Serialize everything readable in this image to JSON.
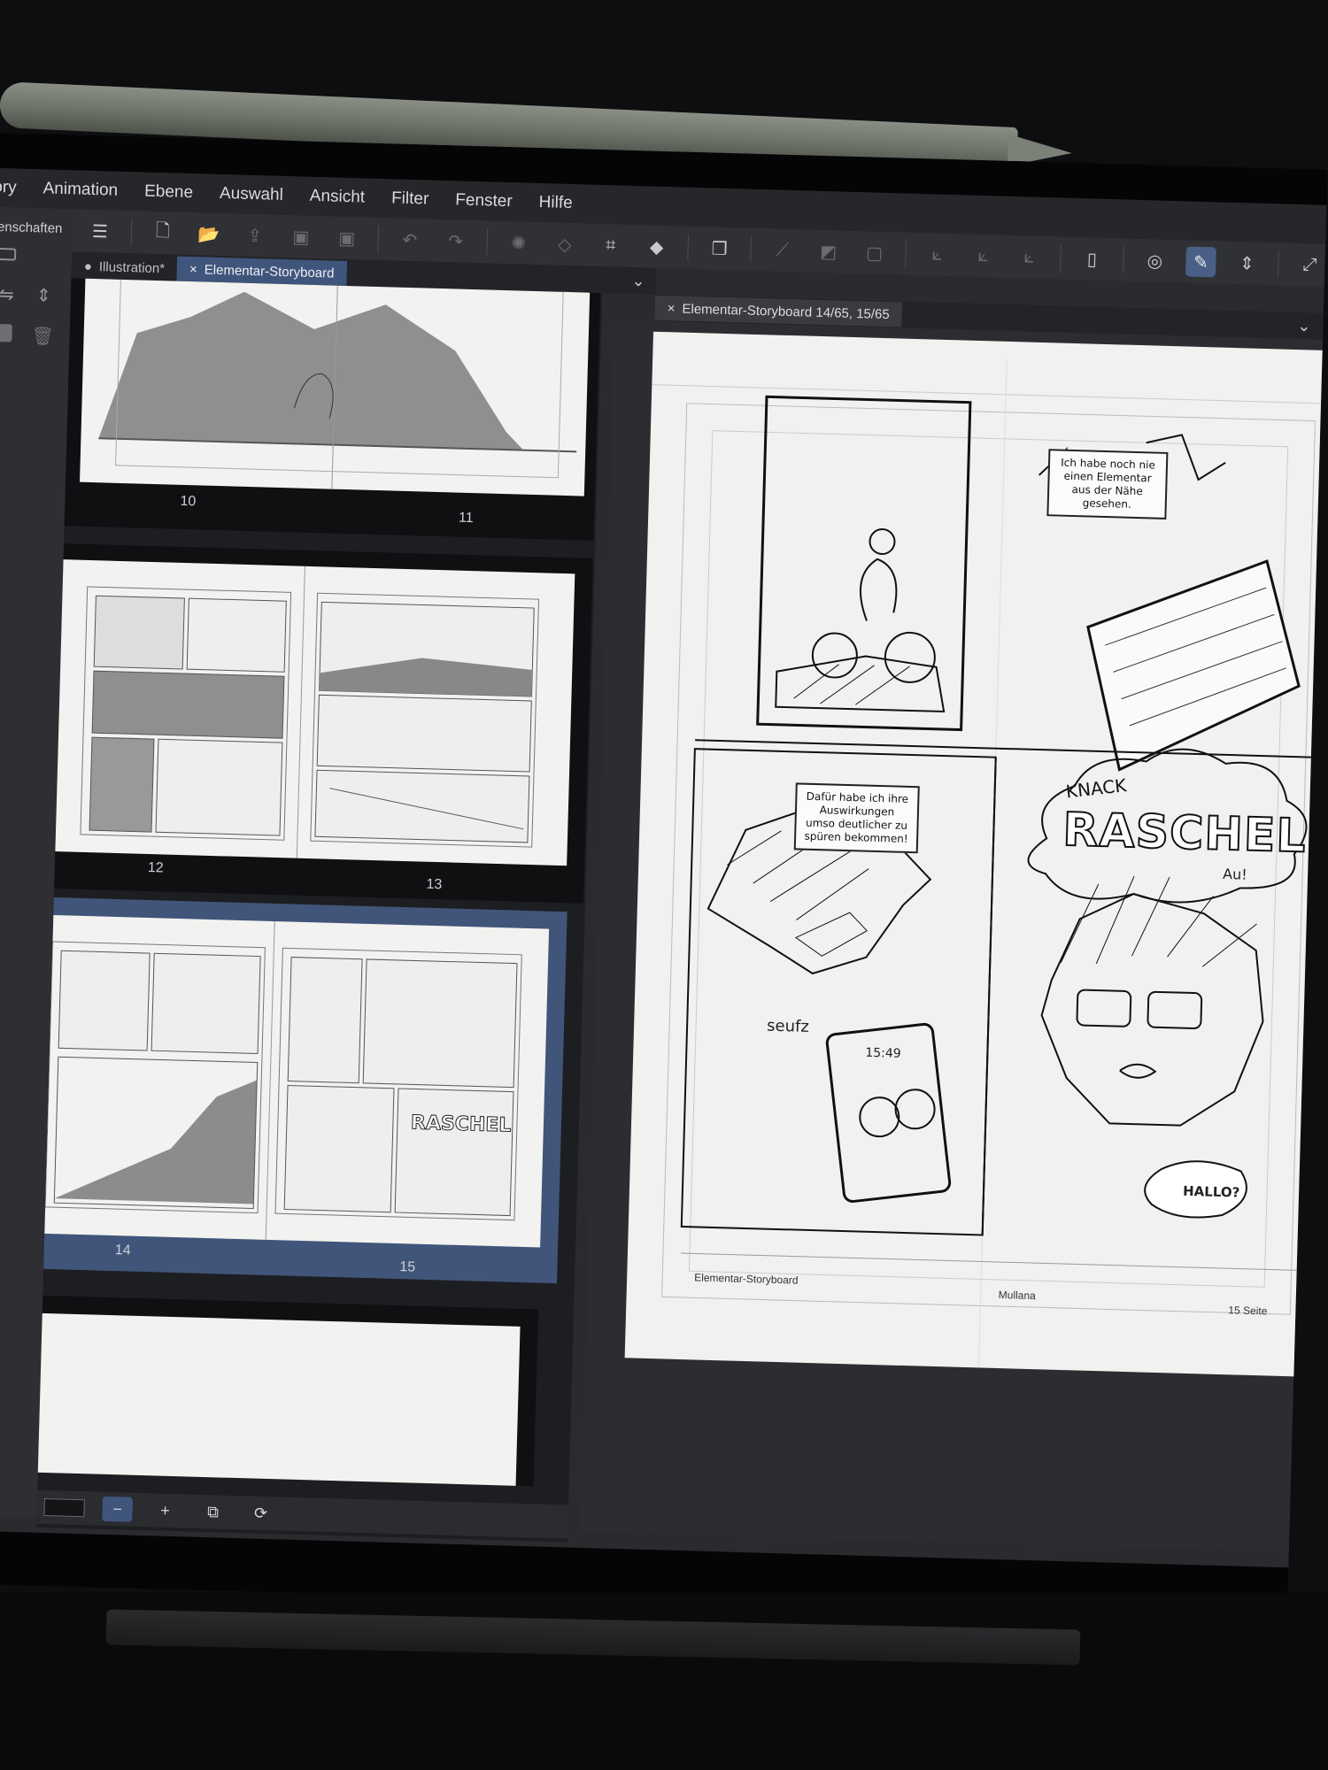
{
  "menu": {
    "items": [
      "ory",
      "Animation",
      "Ebene",
      "Auswahl",
      "Ansicht",
      "Filter",
      "Fenster",
      "Hilfe"
    ]
  },
  "left_panel": {
    "label": "enschaften"
  },
  "tabs_left": [
    {
      "label": "Illustration*",
      "marker": "●"
    },
    {
      "label": "Elementar-Storyboard",
      "marker": "×"
    }
  ],
  "canvas_tab": {
    "label": "Elementar-Storyboard 14/65, 15/65",
    "close": "×"
  },
  "page_list": {
    "spreads": [
      {
        "left_num": "10",
        "right_num": "11",
        "selected": false
      },
      {
        "left_num": "12",
        "right_num": "13",
        "selected": false
      },
      {
        "left_num": "14",
        "right_num": "15",
        "selected": true
      }
    ],
    "bottom_buttons": [
      "−",
      "+",
      "⧉",
      "⟳"
    ]
  },
  "page": {
    "footer_left": "Elementar-Storyboard",
    "footer_center": "Mullana",
    "footer_right": "15 Seite",
    "bubble1": "Ich habe noch nie einen Elementar aus der Nähe gesehen.",
    "bubble2": "Dafür habe ich ihre Auswirkungen umso deutlicher zu spüren bekommen!",
    "sfx_knack": "KNACK",
    "sfx_raschel": "RASCHEL",
    "sfx_au": "Au!",
    "sfx_seufz": "seufz",
    "phone_time": "15:49",
    "hallo": "HALLO?"
  },
  "colors": {
    "accent": "#40557c",
    "paper": "#f1f1ef",
    "ui_bg": "#2a2b2e"
  }
}
